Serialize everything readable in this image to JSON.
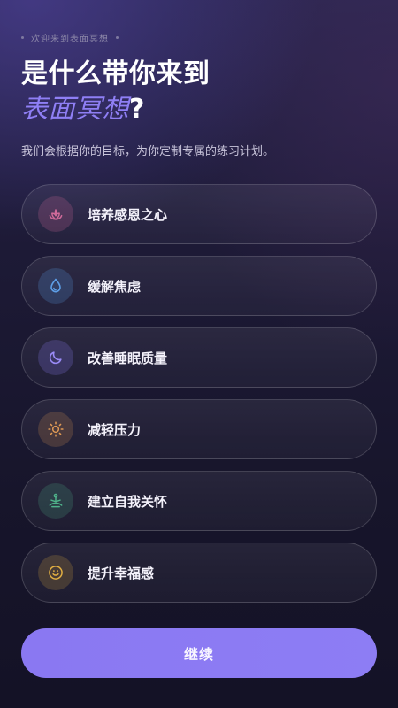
{
  "header": {
    "eyebrow": "欢迎来到表面冥想",
    "title_line1": "是什么带你来到",
    "title_accent": "表面冥想",
    "title_question": "?",
    "subtitle": "我们会根据你的目标，为你定制专属的练习计划。"
  },
  "options": [
    {
      "label": "培养感恩之心",
      "icon": "lotus-icon",
      "color": "#d06a9a"
    },
    {
      "label": "缓解焦虑",
      "icon": "water-drop-icon",
      "color": "#5d9ee6"
    },
    {
      "label": "改善睡眠质量",
      "icon": "moon-icon",
      "color": "#8f7ff5"
    },
    {
      "label": "减轻压力",
      "icon": "sun-icon",
      "color": "#e09a55"
    },
    {
      "label": "建立自我关怀",
      "icon": "meditation-icon",
      "color": "#4fb38a"
    },
    {
      "label": "提升幸福感",
      "icon": "smile-icon",
      "color": "#e3b042"
    }
  ],
  "footer": {
    "continue_label": "继续"
  },
  "colors": {
    "accent": "#8f7ff5",
    "button": "#8b7af3"
  }
}
